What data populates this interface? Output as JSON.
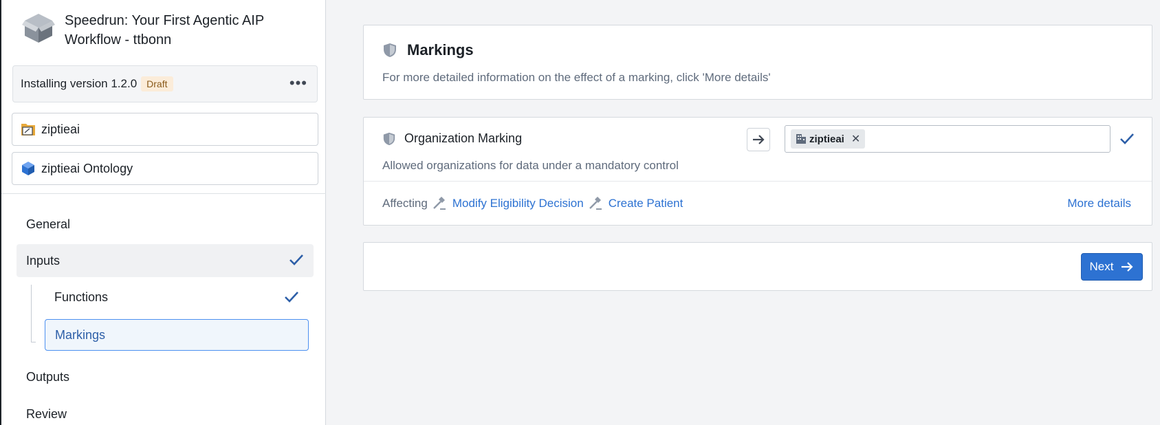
{
  "sidebar": {
    "app_title": "Speedrun: Your First Agentic AIP Workflow - ttbonn",
    "version_text": "Installing version 1.2.0",
    "draft_label": "Draft",
    "more_label": "•••",
    "resources": [
      {
        "label": "ziptieai",
        "icon": "folder-icon"
      },
      {
        "label": "ziptieai Ontology",
        "icon": "cube-icon"
      }
    ],
    "nav": {
      "general": "General",
      "inputs": "Inputs",
      "functions": "Functions",
      "markings": "Markings",
      "outputs": "Outputs",
      "review": "Review"
    }
  },
  "header_card": {
    "title": "Markings",
    "description": "For more detailed information on the effect of a marking, click 'More details'"
  },
  "marking_card": {
    "title": "Organization Marking",
    "tag_label": "ziptieai",
    "tag_remove": "✕",
    "description": "Allowed organizations for data under a mandatory control",
    "affecting_label": "Affecting",
    "affected_items": [
      "Modify Eligibility Decision",
      "Create Patient"
    ],
    "more_details": "More details"
  },
  "next_card": {
    "next_label": "Next"
  },
  "colors": {
    "primary": "#2d72d2",
    "draft_bg": "#fbecd9",
    "selected_border": "#4c90f0"
  }
}
